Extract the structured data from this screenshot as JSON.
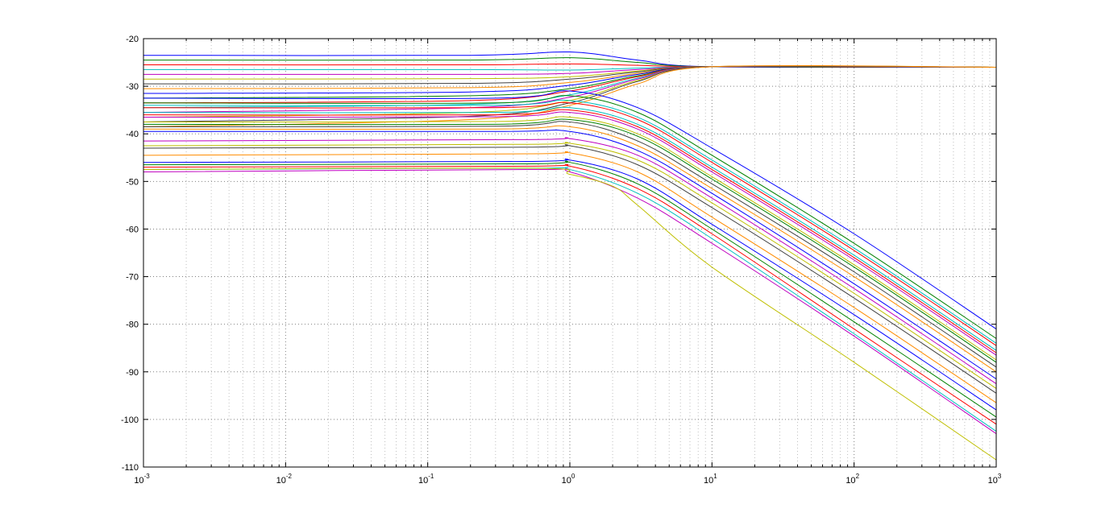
{
  "chart_data": {
    "type": "line",
    "title": "",
    "xlabel": "",
    "ylabel": "",
    "x_scale": "log",
    "xlim": [
      0.001,
      1000
    ],
    "ylim": [
      -110,
      -20
    ],
    "grid": true,
    "grid_style": "dotted",
    "legend": "none",
    "x_ticks": [
      {
        "base": "10",
        "exp": "-3"
      },
      {
        "base": "10",
        "exp": "-2"
      },
      {
        "base": "10",
        "exp": "-1"
      },
      {
        "base": "10",
        "exp": "0"
      },
      {
        "base": "10",
        "exp": "1"
      },
      {
        "base": "10",
        "exp": "2"
      },
      {
        "base": "10",
        "exp": "3"
      }
    ],
    "y_ticks": [
      "-20",
      "-30",
      "-40",
      "-50",
      "-60",
      "-70",
      "-80",
      "-90",
      "-100",
      "-110"
    ],
    "series_colors": [
      "#0000ff",
      "#008000",
      "#ff0000",
      "#00bfbf",
      "#bf00bf",
      "#bfbf00",
      "#404040",
      "#ff8c00"
    ],
    "series": [
      {
        "x": [
          0.001,
          0.2,
          1,
          3,
          10,
          1000
        ],
        "y": [
          -23.5,
          -23.5,
          -22.8,
          -24.5,
          -25.9,
          -26.0
        ]
      },
      {
        "x": [
          0.001,
          0.2,
          1,
          3,
          10,
          1000
        ],
        "y": [
          -24.5,
          -24.5,
          -24.0,
          -25.0,
          -25.9,
          -26.0
        ]
      },
      {
        "x": [
          0.001,
          0.2,
          1,
          3,
          10,
          1000
        ],
        "y": [
          -25.5,
          -25.5,
          -25.3,
          -25.6,
          -25.9,
          -26.0
        ]
      },
      {
        "x": [
          0.001,
          0.2,
          1,
          3,
          10,
          1000
        ],
        "y": [
          -26.5,
          -26.5,
          -26.6,
          -26.2,
          -25.9,
          -26.0
        ]
      },
      {
        "x": [
          0.001,
          0.2,
          1,
          3,
          10,
          1000
        ],
        "y": [
          -27.5,
          -27.5,
          -27.3,
          -26.5,
          -25.9,
          -26.0
        ]
      },
      {
        "x": [
          0.001,
          0.2,
          1,
          3,
          10,
          1000
        ],
        "y": [
          -28.5,
          -28.4,
          -28.0,
          -26.8,
          -25.9,
          -26.0
        ]
      },
      {
        "x": [
          0.001,
          0.2,
          1,
          3,
          10,
          1000
        ],
        "y": [
          -29.5,
          -29.4,
          -28.5,
          -27.0,
          -25.9,
          -26.0
        ]
      },
      {
        "x": [
          0.001,
          0.2,
          1,
          3,
          10,
          1000
        ],
        "y": [
          -30.5,
          -30.3,
          -29.2,
          -27.3,
          -25.9,
          -26.0
        ]
      },
      {
        "x": [
          0.001,
          0.2,
          1,
          3,
          10,
          1000
        ],
        "y": [
          -31.5,
          -31.2,
          -29.8,
          -27.5,
          -25.9,
          -26.0
        ]
      },
      {
        "x": [
          0.001,
          0.2,
          1,
          3,
          10,
          1000
        ],
        "y": [
          -32.5,
          -32.0,
          -30.5,
          -27.8,
          -25.9,
          -26.0
        ]
      },
      {
        "x": [
          0.001,
          0.2,
          1,
          3,
          10,
          1000
        ],
        "y": [
          -33.5,
          -33.0,
          -31.0,
          -28.0,
          -25.9,
          -26.0
        ]
      },
      {
        "x": [
          0.001,
          0.2,
          1,
          3,
          10,
          1000
        ],
        "y": [
          -34.5,
          -33.8,
          -31.8,
          -28.3,
          -25.9,
          -26.0
        ]
      },
      {
        "x": [
          0.001,
          0.2,
          1,
          3,
          10,
          1000
        ],
        "y": [
          -35.5,
          -34.5,
          -32.3,
          -28.5,
          -25.9,
          -26.0
        ]
      },
      {
        "x": [
          0.001,
          0.2,
          1,
          3,
          10,
          1000
        ],
        "y": [
          -36.5,
          -35.5,
          -33.0,
          -28.8,
          -25.9,
          -26.0
        ]
      },
      {
        "x": [
          0.001,
          0.2,
          1,
          3,
          10,
          1000
        ],
        "y": [
          -37.5,
          -36.3,
          -33.5,
          -29.0,
          -25.9,
          -26.0
        ]
      },
      {
        "x": [
          0.001,
          0.2,
          1,
          3,
          10,
          1000
        ],
        "y": [
          -38.5,
          -37.0,
          -34.0,
          -29.5,
          -25.9,
          -26.0
        ]
      },
      {
        "x": [
          0.001,
          0.3,
          1,
          3,
          10,
          100,
          1000
        ],
        "y": [
          -32.5,
          -32.5,
          -31.0,
          -34.5,
          -43.0,
          -61.0,
          -81.0
        ]
      },
      {
        "x": [
          0.001,
          0.3,
          1,
          3,
          10,
          100,
          1000
        ],
        "y": [
          -33.5,
          -33.5,
          -32.0,
          -35.5,
          -44.5,
          -63.0,
          -83.0
        ]
      },
      {
        "x": [
          0.001,
          0.3,
          1,
          3,
          10,
          100,
          1000
        ],
        "y": [
          -34.5,
          -34.5,
          -33.5,
          -37.0,
          -46.0,
          -64.5,
          -84.5
        ]
      },
      {
        "x": [
          0.001,
          0.3,
          1,
          3,
          10,
          100,
          1000
        ],
        "y": [
          -35.5,
          -35.5,
          -34.5,
          -38.0,
          -47.0,
          -65.5,
          -85.5
        ]
      },
      {
        "x": [
          0.001,
          0.3,
          1,
          3,
          10,
          100,
          1000
        ],
        "y": [
          -36.5,
          -36.4,
          -35.5,
          -39.0,
          -48.0,
          -66.5,
          -86.5
        ]
      },
      {
        "x": [
          0.001,
          0.3,
          1,
          3,
          10,
          100,
          1000
        ],
        "y": [
          -37.5,
          -37.4,
          -36.5,
          -40.0,
          -49.0,
          -67.5,
          -87.5
        ]
      },
      {
        "x": [
          0.001,
          0.3,
          1,
          3,
          10,
          100,
          1000
        ],
        "y": [
          -38.5,
          -38.4,
          -37.5,
          -41.5,
          -50.5,
          -69.0,
          -89.0
        ]
      },
      {
        "x": [
          0.001,
          0.3,
          1,
          3,
          10,
          100,
          1000
        ],
        "y": [
          -39.0,
          -39.0,
          -38.5,
          -42.5,
          -51.5,
          -70.0,
          -90.0
        ]
      },
      {
        "x": [
          0.001,
          0.3,
          1,
          3,
          10,
          100,
          1000
        ],
        "y": [
          -39.5,
          -39.5,
          -39.5,
          -43.5,
          -52.5,
          -71.5,
          -91.5
        ]
      },
      {
        "x": [
          0.001,
          0.3,
          1,
          3,
          10,
          100,
          1000
        ],
        "y": [
          -38.0,
          -38.0,
          -37.0,
          -40.5,
          -49.5,
          -68.0,
          -88.0
        ]
      },
      {
        "x": [
          0.001,
          0.3,
          1,
          3,
          10,
          100,
          1000
        ],
        "y": [
          -36.0,
          -36.0,
          -35.0,
          -38.5,
          -47.5,
          -66.0,
          -86.0
        ]
      },
      {
        "x": [
          0.001,
          0.3,
          1,
          3,
          10,
          100,
          1000
        ],
        "y": [
          -34.0,
          -34.0,
          -33.0,
          -36.5,
          -45.5,
          -64.0,
          -84.0
        ]
      },
      {
        "x": [
          0.001,
          0.5,
          1,
          3,
          10,
          100,
          1000
        ],
        "y": [
          -41.5,
          -41.2,
          -41.0,
          -44.5,
          -53.5,
          -72.5,
          -92.5
        ]
      },
      {
        "x": [
          0.001,
          0.5,
          1,
          3,
          10,
          100,
          1000
        ],
        "y": [
          -42.5,
          -42.2,
          -42.0,
          -45.5,
          -54.5,
          -73.5,
          -93.5
        ]
      },
      {
        "x": [
          0.001,
          0.5,
          1,
          3,
          10,
          100,
          1000
        ],
        "y": [
          -43.0,
          -42.8,
          -42.5,
          -46.5,
          -55.5,
          -74.5,
          -94.5
        ]
      },
      {
        "x": [
          0.001,
          0.5,
          1,
          3,
          10,
          100,
          1000
        ],
        "y": [
          -44.5,
          -44.2,
          -44.0,
          -48.0,
          -57.5,
          -76.5,
          -96.5
        ]
      },
      {
        "x": [
          0.001,
          0.5,
          1,
          3,
          10,
          100,
          1000
        ],
        "y": [
          -46.0,
          -45.8,
          -45.5,
          -49.5,
          -59.0,
          -78.0,
          -98.0
        ]
      },
      {
        "x": [
          0.001,
          0.5,
          1,
          3,
          10,
          100,
          1000
        ],
        "y": [
          -46.5,
          -46.3,
          -46.0,
          -50.5,
          -60.0,
          -79.5,
          -99.5
        ]
      },
      {
        "x": [
          0.001,
          0.5,
          1,
          3,
          10,
          100,
          1000
        ],
        "y": [
          -47.0,
          -46.8,
          -46.8,
          -51.5,
          -61.0,
          -81.0,
          -101.0
        ]
      },
      {
        "x": [
          0.001,
          0.5,
          1,
          3,
          10,
          100,
          1000
        ],
        "y": [
          -47.5,
          -47.2,
          -47.5,
          -52.5,
          -62.0,
          -82.0,
          -102.5
        ]
      },
      {
        "x": [
          0.001,
          0.5,
          1,
          3,
          10,
          100,
          1000
        ],
        "y": [
          -48.0,
          -47.5,
          -48.0,
          -53.5,
          -63.0,
          -82.5,
          -103.0
        ]
      },
      {
        "x": [
          0.001,
          0.5,
          1,
          2,
          3,
          10,
          100,
          1000
        ],
        "y": [
          -47.5,
          -47.2,
          -48.5,
          -51.0,
          -55.0,
          -68.0,
          -88.0,
          -108.5
        ]
      }
    ]
  }
}
